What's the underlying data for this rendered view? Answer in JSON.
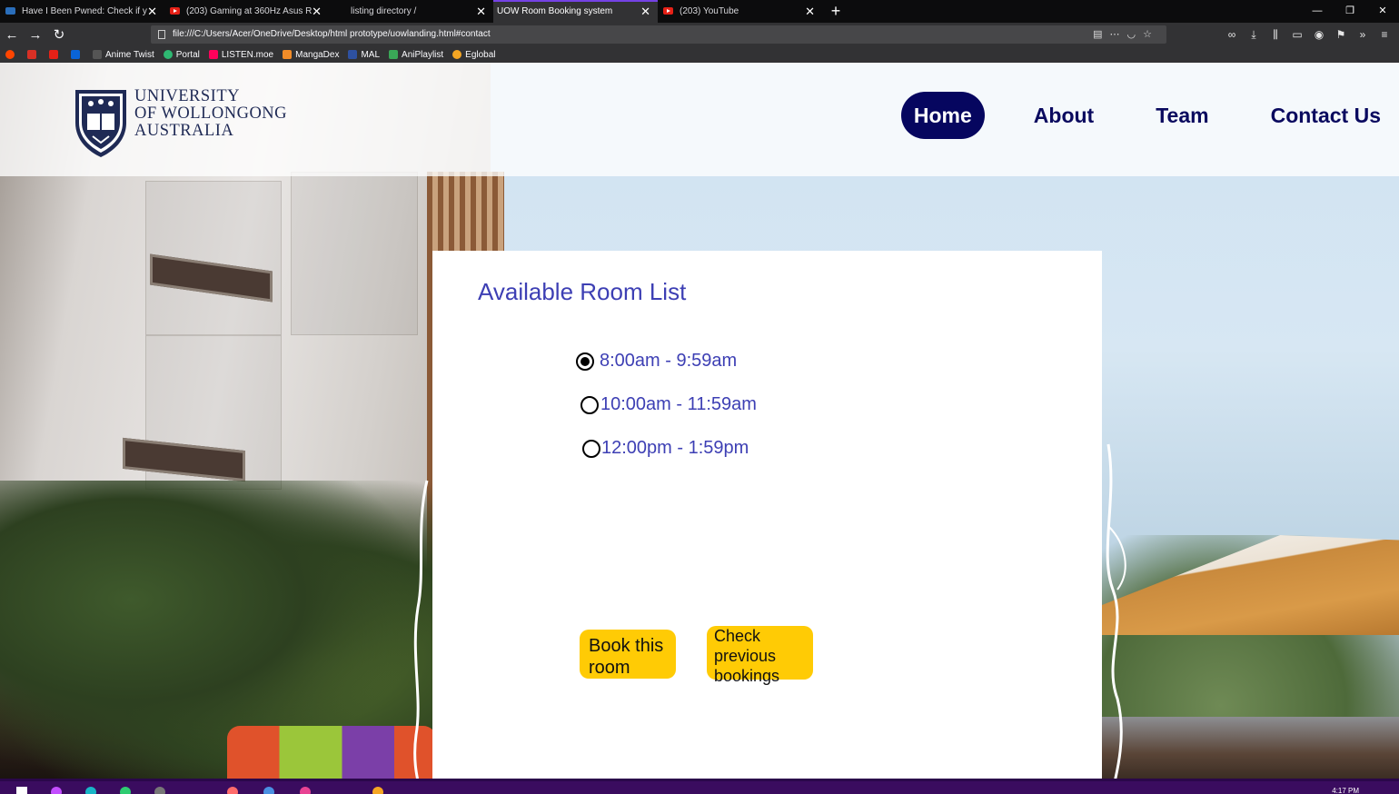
{
  "browser": {
    "tabs": [
      {
        "title": "Have I Been Pwned: Check if y",
        "favicon": "shield-icon",
        "active": false
      },
      {
        "title": "(203) Gaming at 360Hz Asus R",
        "favicon": "youtube-icon",
        "active": false
      },
      {
        "title": "listing directory /",
        "favicon": "page-icon",
        "active": false
      },
      {
        "title": "UOW Room Booking system",
        "favicon": "page-icon",
        "active": true
      },
      {
        "title": "(203) YouTube",
        "favicon": "youtube-icon",
        "active": false
      }
    ],
    "new_tab": "+",
    "url": "file:///C:/Users/Acer/OneDrive/Desktop/html prototype/uowlanding.html#contact",
    "bookmarks": [
      {
        "label": "",
        "icon": "reddit-icon",
        "color": "#ff4500"
      },
      {
        "label": "",
        "icon": "gmail-icon",
        "color": "#d93025"
      },
      {
        "label": "",
        "icon": "youtube-icon",
        "color": "#e62117"
      },
      {
        "label": "",
        "icon": "outlook-icon",
        "color": "#0a64d6"
      },
      {
        "label": "Anime Twist",
        "icon": "anime-twist-icon",
        "color": "#222"
      },
      {
        "label": "Portal",
        "icon": "portal-icon",
        "color": "#2eb872"
      },
      {
        "label": "LISTEN.moe",
        "icon": "listen-icon",
        "color": "#ff015b"
      },
      {
        "label": "MangaDex",
        "icon": "mangadex-icon",
        "color": "#f28c28"
      },
      {
        "label": "MAL",
        "icon": "mal-icon",
        "color": "#2e51a2"
      },
      {
        "label": "AniPlaylist",
        "icon": "aniplaylist-icon",
        "color": "#3aa757"
      },
      {
        "label": "Eglobal",
        "icon": "eglobal-icon",
        "color": "#f5a623"
      }
    ]
  },
  "site": {
    "logo": {
      "line1": "UNIVERSITY",
      "line2": "OF WOLLONGONG",
      "line3": "AUSTRALIA"
    },
    "nav": [
      {
        "label": "Home",
        "active": true
      },
      {
        "label": "About",
        "active": false
      },
      {
        "label": "Team",
        "active": false
      },
      {
        "label": "Contact Us",
        "active": false
      }
    ]
  },
  "booking": {
    "title": "Available Room List",
    "slots": [
      {
        "label": "8:00am - 9:59am",
        "selected": true
      },
      {
        "label": "10:00am - 11:59am",
        "selected": false
      },
      {
        "label": "12:00pm - 1:59pm",
        "selected": false
      }
    ],
    "book_button": "Book this room",
    "history_button": "Check previous bookings"
  },
  "taskbar": {
    "clock": "4:17 PM"
  },
  "colors": {
    "nav_active_bg": "#06065f",
    "nav_text": "#0a0a5f",
    "title": "#3d3fb4",
    "button": "#ffcb05"
  }
}
